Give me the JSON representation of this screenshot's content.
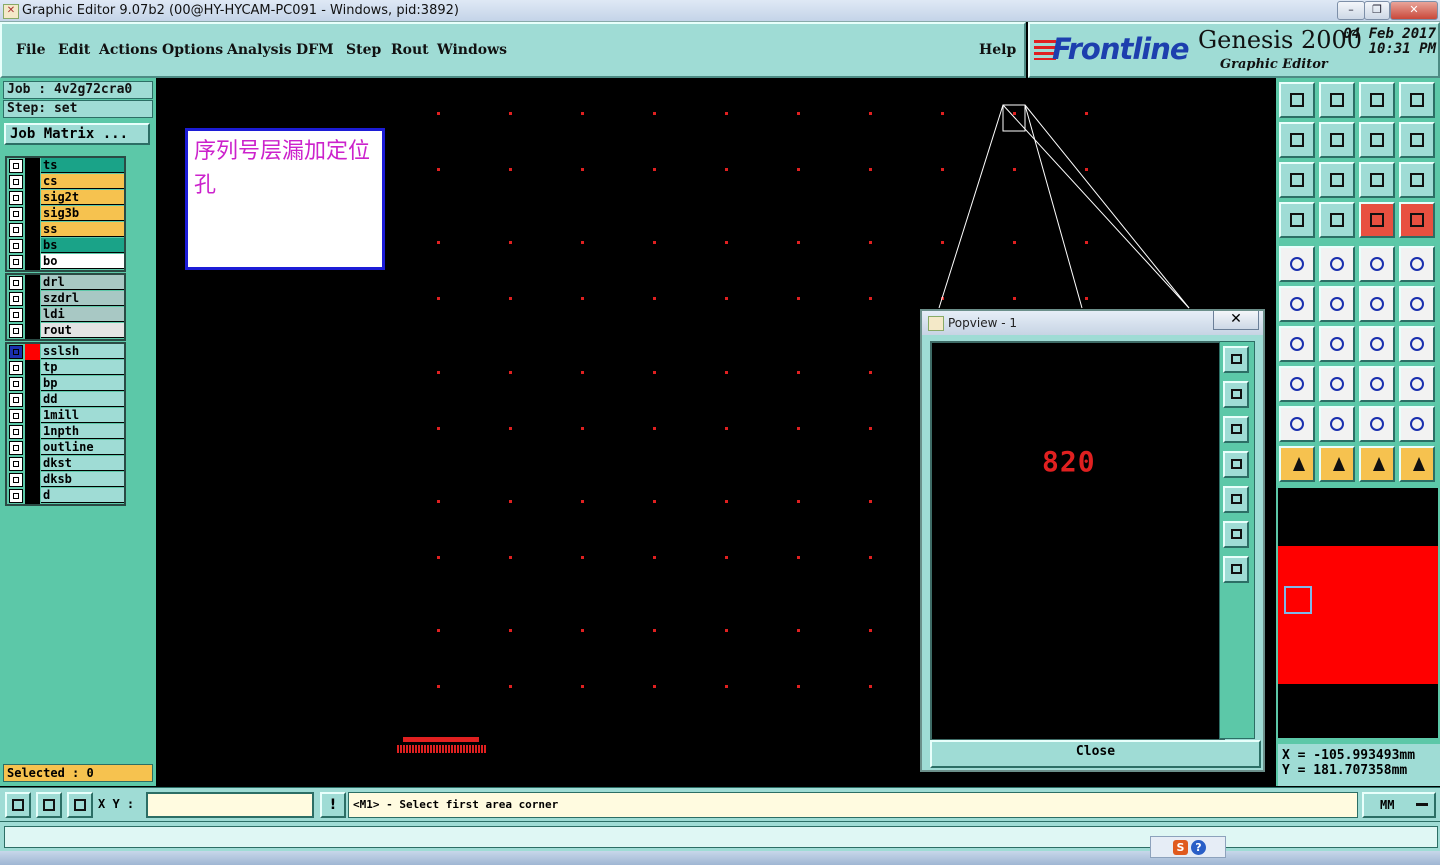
{
  "window": {
    "title": "Graphic Editor 9.07b2 (00@HY-HYCAM-PC091 - Windows, pid:3892)",
    "controls": [
      "–",
      "❐",
      "✕"
    ]
  },
  "menu": {
    "items": [
      "File",
      "Edit",
      "Actions",
      "Options",
      "Analysis",
      "DFM",
      "Step",
      "Rout",
      "Windows"
    ],
    "help": "Help"
  },
  "brand": {
    "logo": "Frontline",
    "product": "Genesis 2000",
    "subtitle": "Graphic Editor",
    "date": "04 Feb 2017",
    "time": "10:31 PM"
  },
  "job": {
    "job_label": "Job : 4v2g72cra0",
    "step_label": "Step: set",
    "matrix_button": "Job Matrix ..."
  },
  "layers": {
    "group1": [
      {
        "name": "ts",
        "color": "#1aa388"
      },
      {
        "name": "cs",
        "color": "#f6c24f"
      },
      {
        "name": "sig2t",
        "color": "#f6c24f"
      },
      {
        "name": "sig3b",
        "color": "#f6c24f"
      },
      {
        "name": "ss",
        "color": "#f6c24f"
      },
      {
        "name": "bs",
        "color": "#1aa388"
      },
      {
        "name": "bo",
        "color": "#ffffff"
      }
    ],
    "group2": [
      {
        "name": "drl",
        "color": "#a8c8c4"
      },
      {
        "name": "szdrl",
        "color": "#a8c8c4"
      },
      {
        "name": "ldi",
        "color": "#a8c8c4"
      },
      {
        "name": "rout",
        "color": "#e4e4e4"
      }
    ],
    "group3": [
      {
        "name": "sslsh",
        "color": "#9fdcd5",
        "active": true
      },
      {
        "name": "tp",
        "color": "#9fdcd5"
      },
      {
        "name": "bp",
        "color": "#9fdcd5"
      },
      {
        "name": "dd",
        "color": "#9fdcd5"
      },
      {
        "name": "1mill",
        "color": "#9fdcd5"
      },
      {
        "name": "1npth",
        "color": "#9fdcd5"
      },
      {
        "name": "outline",
        "color": "#9fdcd5"
      },
      {
        "name": "dkst",
        "color": "#9fdcd5"
      },
      {
        "name": "dksb",
        "color": "#9fdcd5"
      },
      {
        "name": "d",
        "color": "#9fdcd5"
      }
    ]
  },
  "selected": "Selected : 0",
  "annotation": "序列号层漏加定位孔",
  "popview": {
    "title": "Popview - 1",
    "content": "820",
    "close_label": "Close"
  },
  "coords": {
    "x": "X = -105.993493mm",
    "y": "Y = 181.707358mm"
  },
  "command": {
    "xy_label": "X Y :",
    "xy_value": "",
    "message": "<M1> - Select first area corner",
    "units": "MM"
  },
  "tray": [
    "S",
    "?"
  ],
  "accent": {
    "panel": "#9fdcd5",
    "panel_dark": "#5cc8a8",
    "highlight": "#f6c24f",
    "feature_red": "#e02020"
  }
}
